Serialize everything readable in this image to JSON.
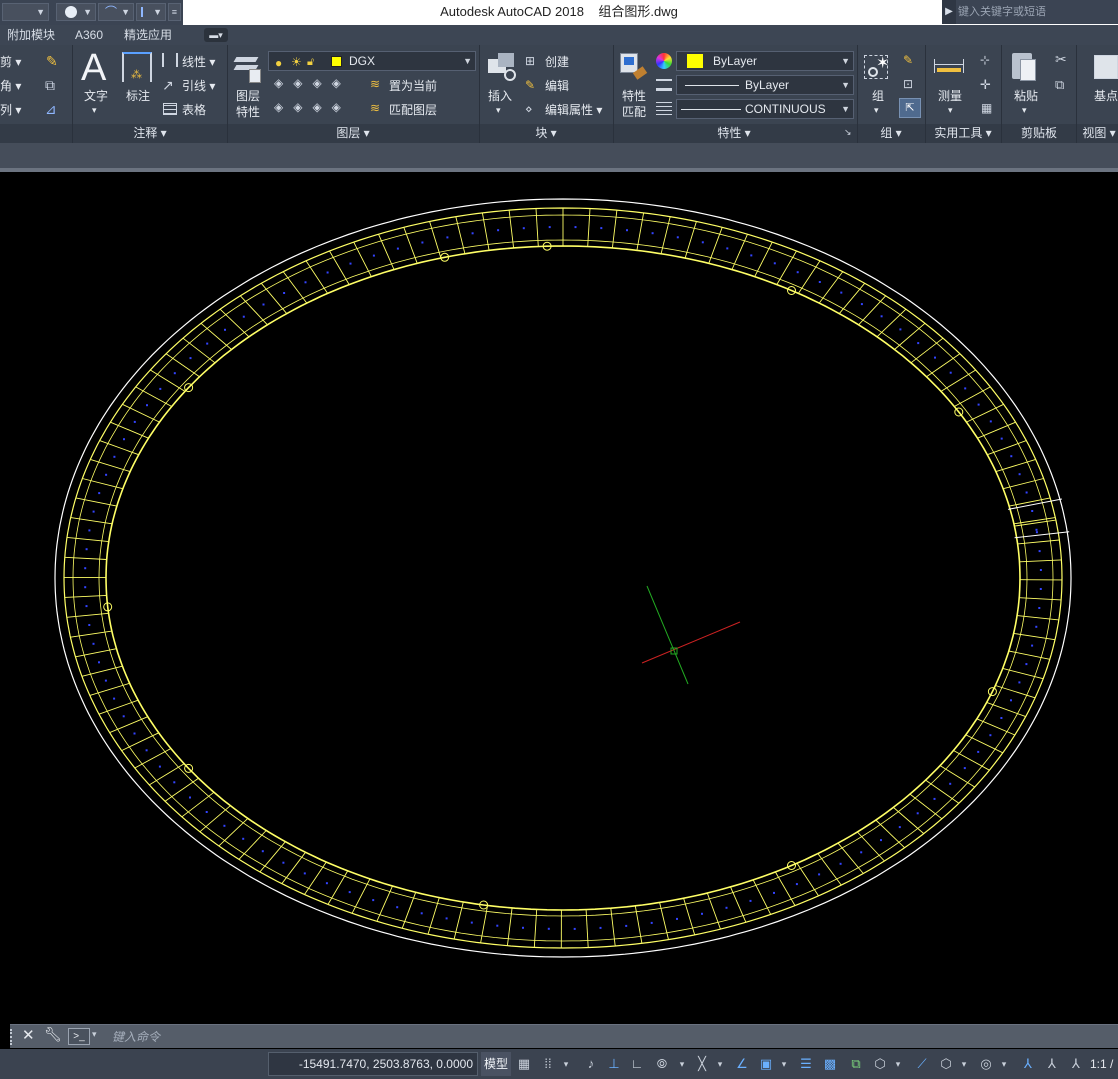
{
  "window": {
    "title": "Autodesk AutoCAD 2018",
    "filename": "组合图形.dwg",
    "search_placeholder": "键入关键字或短语"
  },
  "ribbon_tabs": [
    "附加模块",
    "A360",
    "精选应用"
  ],
  "panels": {
    "modify": {
      "items": [
        "剪",
        "角",
        "列"
      ]
    },
    "annotation": {
      "label": "注释",
      "text_button": "文字",
      "dimension_button": "标注",
      "linear": "线性",
      "leader": "引线",
      "table": "表格"
    },
    "layers": {
      "label": "图层",
      "layer_properties": [
        "图层",
        "特性"
      ],
      "current_layer": "DGX",
      "make_current": "置为当前",
      "match_layer": "匹配图层"
    },
    "block": {
      "label": "块",
      "insert": "插入",
      "create": "创建",
      "edit": "编辑",
      "edit_attributes": "编辑属性"
    },
    "properties": {
      "label": "特性",
      "match_properties": [
        "特性",
        "匹配"
      ],
      "color": "ByLayer",
      "lineweight": "ByLayer",
      "linetype": "CONTINUOUS",
      "color_swatch": "#ffff00"
    },
    "groups": {
      "label": "组",
      "group_button": "组"
    },
    "utilities": {
      "label": "实用工具",
      "measure_button": "测量"
    },
    "clipboard": {
      "label": "剪贴板",
      "paste_button": "粘贴"
    },
    "view": {
      "label": "视图",
      "base_button": "基点"
    }
  },
  "command_line": {
    "placeholder": "键入命令"
  },
  "status_bar": {
    "coordinates": "-15491.7470, 2503.8763, 0.0000",
    "model_button": "模型",
    "scale": "1:1 /"
  },
  "colors": {
    "drawing_background": "#000000",
    "geometry": "#ffff66",
    "outline": "#ffffff",
    "markers": "#3344ff",
    "ucs_x": "#cc2222",
    "ucs_y": "#22aa22"
  }
}
